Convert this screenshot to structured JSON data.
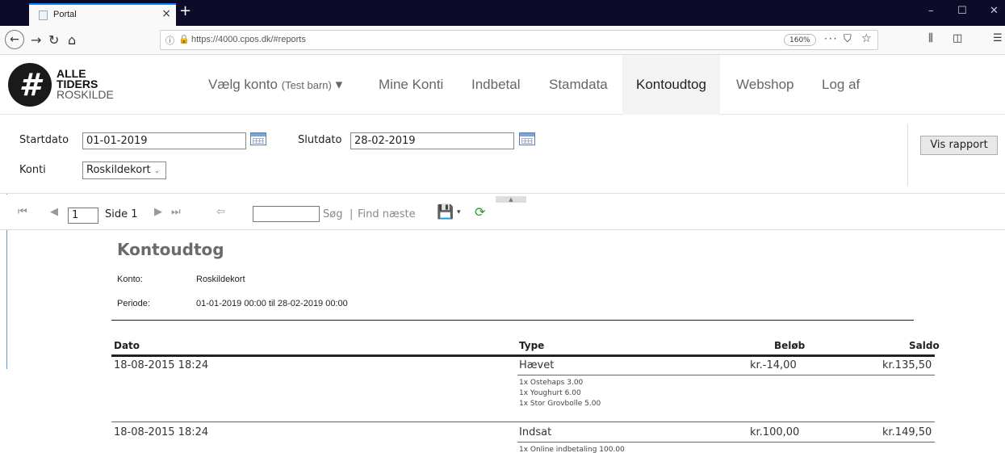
{
  "browser": {
    "tab_title": "Portal",
    "url": "https://4000.cpos.dk/#reports",
    "zoom": "160%",
    "more": "···"
  },
  "app": {
    "logo": {
      "line1": "ALLE",
      "line2": "TIDERS",
      "line3": "ROSKILDE",
      "symbol": "#"
    },
    "nav": [
      {
        "label": "Vælg konto",
        "sub": "(Test barn)",
        "caret": "▾"
      },
      {
        "label": "Mine Konti"
      },
      {
        "label": "Indbetal"
      },
      {
        "label": "Stamdata"
      },
      {
        "label": "Kontoudtog"
      },
      {
        "label": "Webshop"
      },
      {
        "label": "Log af"
      }
    ]
  },
  "params": {
    "start_label": "Startdato",
    "start_value": "01-01-2019",
    "end_label": "Slutdato",
    "end_value": "28-02-2019",
    "account_label": "Konti",
    "account_value": "Roskildekort",
    "show_report": "Vis rapport"
  },
  "toolbar": {
    "page_value": "1",
    "page_label": "Side 1",
    "search": "Søg",
    "sep": "|",
    "find_next": "Find næste"
  },
  "report": {
    "title": "Kontoudtog",
    "account_key": "Konto:",
    "account_val": "Roskildekort",
    "period_key": "Periode:",
    "period_val": "01-01-2019 00:00 til 28-02-2019 00:00",
    "columns": {
      "date": "Dato",
      "type": "Type",
      "amount": "Beløb",
      "balance": "Saldo"
    },
    "rows": [
      {
        "date": "18-08-2015 18:24",
        "type": "Hævet",
        "amount": "kr.-14,00",
        "balance": "kr.135,50",
        "items": [
          "1x Ostehaps 3.00",
          "1x Youghurt 6.00",
          "1x Stor Grovbolle 5.00"
        ]
      },
      {
        "date": "18-08-2015 18:24",
        "type": "Indsat",
        "amount": "kr.100,00",
        "balance": "kr.149,50",
        "items": [
          "1x Online indbetaling 100.00"
        ]
      }
    ]
  }
}
